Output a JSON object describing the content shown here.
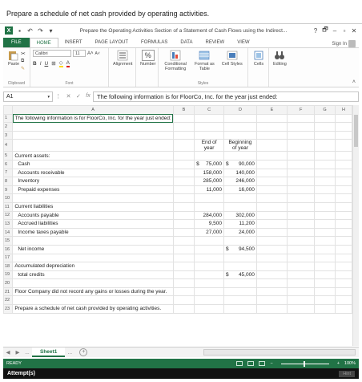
{
  "instruction": "Prepare a schedule of net cash provided by operating activities.",
  "titlebar": {
    "app_icon": "X",
    "doc_title": "Prepare the Operating Activities Section of a Statement of Cash Flows using the Indirect...",
    "help": "?",
    "minimize": "–",
    "restore": "🗗",
    "close": "✕"
  },
  "tabs": {
    "file": "FILE",
    "items": [
      "HOME",
      "INSERT",
      "PAGE LAYOUT",
      "FORMULAS",
      "DATA",
      "REVIEW",
      "VIEW"
    ],
    "sign_in": "Sign In"
  },
  "ribbon": {
    "paste": "Paste",
    "clipboard": "Clipboard",
    "font_name": "Calibri",
    "font_size": "11",
    "bold": "B",
    "italic": "I",
    "underline": "U",
    "font_group": "Font",
    "alignment": "Alignment",
    "number": "Number",
    "number_icon": "%",
    "conditional": "Conditional Formatting",
    "format_as": "Format as Table",
    "cell_styles": "Cell Styles",
    "styles_group": "Styles",
    "cells": "Cells",
    "editing": "Editing"
  },
  "formula_bar": {
    "name_box": "A1",
    "fx": "fx",
    "content": "The following information is for FloorCo, Inc. for the year just ended:"
  },
  "columns": [
    "A",
    "B",
    "C",
    "D",
    "E",
    "F",
    "G",
    "H"
  ],
  "rows": [
    {
      "n": "1",
      "a": "The following information is for FloorCo, Inc. for the year just ended:"
    },
    {
      "n": "2"
    },
    {
      "n": "3"
    },
    {
      "n": "4",
      "c": "End of year",
      "d": "Beginning of year"
    },
    {
      "n": "5",
      "a": "Current assets:"
    },
    {
      "n": "6",
      "a": "Cash",
      "c_sym": "$",
      "c": "75,000",
      "d_sym": "$",
      "d": "90,000"
    },
    {
      "n": "7",
      "a": "Accounts receivable",
      "c": "158,000",
      "d": "140,000"
    },
    {
      "n": "8",
      "a": "Inventory",
      "c": "285,000",
      "d": "246,000"
    },
    {
      "n": "9",
      "a": "Prepaid expenses",
      "c": "11,000",
      "d": "16,000"
    },
    {
      "n": "10"
    },
    {
      "n": "11",
      "a": "Current liabilities"
    },
    {
      "n": "12",
      "a": "Accounts payable",
      "c": "284,000",
      "d": "302,000"
    },
    {
      "n": "13",
      "a": "Accrued liabilities",
      "c": "9,500",
      "d": "11,200"
    },
    {
      "n": "14",
      "a": "Income taxes payable",
      "c": "27,000",
      "d": "24,000"
    },
    {
      "n": "15"
    },
    {
      "n": "16",
      "a": "Net income",
      "d_sym": "$",
      "d": "94,500"
    },
    {
      "n": "17"
    },
    {
      "n": "18",
      "a": "Accumulated depreciation"
    },
    {
      "n": "19",
      "a": "total credits",
      "d_sym": "$",
      "d": "45,000"
    },
    {
      "n": "20"
    },
    {
      "n": "21",
      "a": "Floor Company did not record any gains or losses during the year."
    },
    {
      "n": "22"
    },
    {
      "n": "23",
      "a": "Prepare a schedule of net cash provided by operating activities."
    }
  ],
  "sheetbar": {
    "prev": "◀",
    "next": "▶",
    "more": "...",
    "sheet_name": "Sheet1",
    "more2": "...",
    "add": "+"
  },
  "statusbar": {
    "ready": "READY",
    "zoom": "100%"
  },
  "attempts": {
    "label": "Attempt(s)",
    "hint": "Hint"
  }
}
